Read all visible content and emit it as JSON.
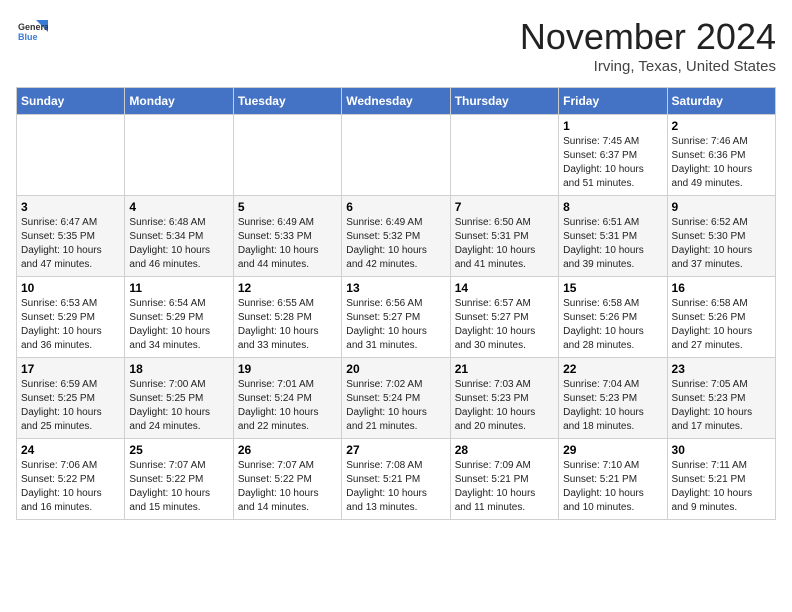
{
  "header": {
    "logo_general": "General",
    "logo_blue": "Blue",
    "month_year": "November 2024",
    "location": "Irving, Texas, United States"
  },
  "days_of_week": [
    "Sunday",
    "Monday",
    "Tuesday",
    "Wednesday",
    "Thursday",
    "Friday",
    "Saturday"
  ],
  "weeks": [
    [
      {
        "day": "",
        "info": ""
      },
      {
        "day": "",
        "info": ""
      },
      {
        "day": "",
        "info": ""
      },
      {
        "day": "",
        "info": ""
      },
      {
        "day": "",
        "info": ""
      },
      {
        "day": "1",
        "info": "Sunrise: 7:45 AM\nSunset: 6:37 PM\nDaylight: 10 hours\nand 51 minutes."
      },
      {
        "day": "2",
        "info": "Sunrise: 7:46 AM\nSunset: 6:36 PM\nDaylight: 10 hours\nand 49 minutes."
      }
    ],
    [
      {
        "day": "3",
        "info": "Sunrise: 6:47 AM\nSunset: 5:35 PM\nDaylight: 10 hours\nand 47 minutes."
      },
      {
        "day": "4",
        "info": "Sunrise: 6:48 AM\nSunset: 5:34 PM\nDaylight: 10 hours\nand 46 minutes."
      },
      {
        "day": "5",
        "info": "Sunrise: 6:49 AM\nSunset: 5:33 PM\nDaylight: 10 hours\nand 44 minutes."
      },
      {
        "day": "6",
        "info": "Sunrise: 6:49 AM\nSunset: 5:32 PM\nDaylight: 10 hours\nand 42 minutes."
      },
      {
        "day": "7",
        "info": "Sunrise: 6:50 AM\nSunset: 5:31 PM\nDaylight: 10 hours\nand 41 minutes."
      },
      {
        "day": "8",
        "info": "Sunrise: 6:51 AM\nSunset: 5:31 PM\nDaylight: 10 hours\nand 39 minutes."
      },
      {
        "day": "9",
        "info": "Sunrise: 6:52 AM\nSunset: 5:30 PM\nDaylight: 10 hours\nand 37 minutes."
      }
    ],
    [
      {
        "day": "10",
        "info": "Sunrise: 6:53 AM\nSunset: 5:29 PM\nDaylight: 10 hours\nand 36 minutes."
      },
      {
        "day": "11",
        "info": "Sunrise: 6:54 AM\nSunset: 5:29 PM\nDaylight: 10 hours\nand 34 minutes."
      },
      {
        "day": "12",
        "info": "Sunrise: 6:55 AM\nSunset: 5:28 PM\nDaylight: 10 hours\nand 33 minutes."
      },
      {
        "day": "13",
        "info": "Sunrise: 6:56 AM\nSunset: 5:27 PM\nDaylight: 10 hours\nand 31 minutes."
      },
      {
        "day": "14",
        "info": "Sunrise: 6:57 AM\nSunset: 5:27 PM\nDaylight: 10 hours\nand 30 minutes."
      },
      {
        "day": "15",
        "info": "Sunrise: 6:58 AM\nSunset: 5:26 PM\nDaylight: 10 hours\nand 28 minutes."
      },
      {
        "day": "16",
        "info": "Sunrise: 6:58 AM\nSunset: 5:26 PM\nDaylight: 10 hours\nand 27 minutes."
      }
    ],
    [
      {
        "day": "17",
        "info": "Sunrise: 6:59 AM\nSunset: 5:25 PM\nDaylight: 10 hours\nand 25 minutes."
      },
      {
        "day": "18",
        "info": "Sunrise: 7:00 AM\nSunset: 5:25 PM\nDaylight: 10 hours\nand 24 minutes."
      },
      {
        "day": "19",
        "info": "Sunrise: 7:01 AM\nSunset: 5:24 PM\nDaylight: 10 hours\nand 22 minutes."
      },
      {
        "day": "20",
        "info": "Sunrise: 7:02 AM\nSunset: 5:24 PM\nDaylight: 10 hours\nand 21 minutes."
      },
      {
        "day": "21",
        "info": "Sunrise: 7:03 AM\nSunset: 5:23 PM\nDaylight: 10 hours\nand 20 minutes."
      },
      {
        "day": "22",
        "info": "Sunrise: 7:04 AM\nSunset: 5:23 PM\nDaylight: 10 hours\nand 18 minutes."
      },
      {
        "day": "23",
        "info": "Sunrise: 7:05 AM\nSunset: 5:23 PM\nDaylight: 10 hours\nand 17 minutes."
      }
    ],
    [
      {
        "day": "24",
        "info": "Sunrise: 7:06 AM\nSunset: 5:22 PM\nDaylight: 10 hours\nand 16 minutes."
      },
      {
        "day": "25",
        "info": "Sunrise: 7:07 AM\nSunset: 5:22 PM\nDaylight: 10 hours\nand 15 minutes."
      },
      {
        "day": "26",
        "info": "Sunrise: 7:07 AM\nSunset: 5:22 PM\nDaylight: 10 hours\nand 14 minutes."
      },
      {
        "day": "27",
        "info": "Sunrise: 7:08 AM\nSunset: 5:21 PM\nDaylight: 10 hours\nand 13 minutes."
      },
      {
        "day": "28",
        "info": "Sunrise: 7:09 AM\nSunset: 5:21 PM\nDaylight: 10 hours\nand 11 minutes."
      },
      {
        "day": "29",
        "info": "Sunrise: 7:10 AM\nSunset: 5:21 PM\nDaylight: 10 hours\nand 10 minutes."
      },
      {
        "day": "30",
        "info": "Sunrise: 7:11 AM\nSunset: 5:21 PM\nDaylight: 10 hours\nand 9 minutes."
      }
    ]
  ]
}
